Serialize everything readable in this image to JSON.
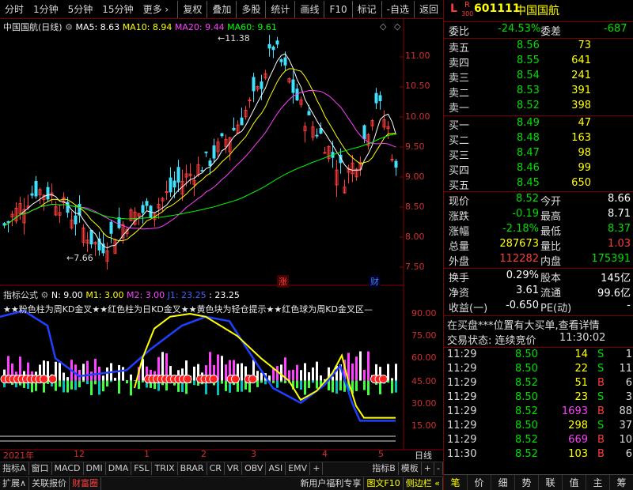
{
  "toolbar": {
    "left": [
      "分时",
      "1分钟",
      "5分钟",
      "15分钟",
      "更多"
    ],
    "right": [
      "复权",
      "叠加",
      "多股",
      "统计",
      "画线",
      "F10",
      "标记",
      "-自选",
      "返回"
    ]
  },
  "kline": {
    "name": "中国国航(日线)",
    "ma5": "MA5: 8.63",
    "ma10": "MA10: 8.94",
    "ma20": "MA20: 9.44",
    "ma60": "MA60: 9.61",
    "high_label": "11.38",
    "low_label": "7.66",
    "axis": [
      "11.00",
      "10.50",
      "10.00",
      "9.50",
      "9.00",
      "8.50",
      "8.00",
      "7.50"
    ],
    "tag_zhang": "涨",
    "tag_cai": "财"
  },
  "indicator": {
    "name": "指标公式",
    "n": "N: 9.00",
    "m1": "M1: 3.00",
    "m2": "M2: 3.00",
    "j1": "J1: 23.25",
    "v": ": 23.25",
    "desc": "★★粉色柱为周KD金叉★★红色柱为日KD金叉★★黄色块为轻仓提示★★红色球为周KD金叉区—",
    "axis": [
      "90.00",
      "75.00",
      "60.00",
      "45.00",
      "30.00",
      "15.00"
    ]
  },
  "time_axis": {
    "labels": [
      "2021年",
      "12",
      "1",
      "2",
      "3",
      "4",
      "5"
    ],
    "period": "日线"
  },
  "tabs1": [
    "指标A",
    "窗口",
    "MACD",
    "DMI",
    "DMA",
    "FSL",
    "TRIX",
    "BRAR",
    "CR",
    "VR",
    "OBV",
    "ASI",
    "EMV",
    "+",
    "指标B",
    "模板",
    "+",
    "-"
  ],
  "tabs2": [
    "扩展∧",
    "关联报价",
    "财富圈"
  ],
  "tabs2_right": [
    "新用户福利专享",
    "图文F10",
    "侧边栏 «"
  ],
  "stock": {
    "flag_l": "L",
    "flag_r": "R",
    "code": "601111",
    "name": "中国国航",
    "sub": "300"
  },
  "weibi": {
    "label": "委比",
    "value": "-24.53%",
    "label2": "委差",
    "value2": "-687"
  },
  "sells": [
    {
      "label": "卖五",
      "price": "8.56",
      "vol": "73"
    },
    {
      "label": "卖四",
      "price": "8.55",
      "vol": "641"
    },
    {
      "label": "卖三",
      "price": "8.54",
      "vol": "241"
    },
    {
      "label": "卖二",
      "price": "8.53",
      "vol": "391"
    },
    {
      "label": "卖一",
      "price": "8.52",
      "vol": "398"
    }
  ],
  "buys": [
    {
      "label": "买一",
      "price": "8.49",
      "vol": "47"
    },
    {
      "label": "买二",
      "price": "8.48",
      "vol": "163"
    },
    {
      "label": "买三",
      "price": "8.47",
      "vol": "98"
    },
    {
      "label": "买四",
      "price": "8.46",
      "vol": "99"
    },
    {
      "label": "买五",
      "price": "8.45",
      "vol": "650"
    }
  ],
  "quote": [
    {
      "l1": "现价",
      "v1": "8.52",
      "l2": "今开",
      "v2": "8.66"
    },
    {
      "l1": "涨跌",
      "v1": "-0.19",
      "l2": "最高",
      "v2": "8.71"
    },
    {
      "l1": "涨幅",
      "v1": "-2.18%",
      "l2": "最低",
      "v2": "8.37"
    },
    {
      "l1": "总量",
      "v1": "287673",
      "l2": "量比",
      "v2": "1.03"
    },
    {
      "l1": "外盘",
      "v1": "112282",
      "l2": "内盘",
      "v2": "175391"
    }
  ],
  "quote2": [
    {
      "l1": "换手",
      "v1": "0.29%",
      "l2": "股本",
      "v2": "145亿"
    },
    {
      "l1": "净资",
      "v1": "3.61",
      "l2": "流通",
      "v2": "99.6亿"
    },
    {
      "l1": "收益(一)",
      "v1": "-0.650",
      "l2": "PE(动)",
      "v2": "-"
    }
  ],
  "notice": "在买盘***位置有大买单,查看详情",
  "status": {
    "label": "交易状态: 连续竞价",
    "time": "11:30:02"
  },
  "ticks": [
    {
      "t": "11:29",
      "p": "8.50",
      "v": "14",
      "s": "S",
      "n": "1"
    },
    {
      "t": "11:29",
      "p": "8.50",
      "v": "22",
      "s": "S",
      "n": "11"
    },
    {
      "t": "11:29",
      "p": "8.52",
      "v": "51",
      "s": "B",
      "n": "6"
    },
    {
      "t": "11:29",
      "p": "8.50",
      "v": "23",
      "s": "S",
      "n": "3"
    },
    {
      "t": "11:29",
      "p": "8.52",
      "v": "1693",
      "s": "B",
      "n": "88"
    },
    {
      "t": "11:29",
      "p": "8.50",
      "v": "298",
      "s": "S",
      "n": "37"
    },
    {
      "t": "11:29",
      "p": "8.52",
      "v": "669",
      "s": "B",
      "n": "10"
    },
    {
      "t": "11:30",
      "p": "8.52",
      "v": "103",
      "s": "B",
      "n": "6"
    }
  ],
  "rp_tabs": [
    "笔",
    "价",
    "细",
    "势",
    "联",
    "值",
    "主",
    "筹"
  ]
}
